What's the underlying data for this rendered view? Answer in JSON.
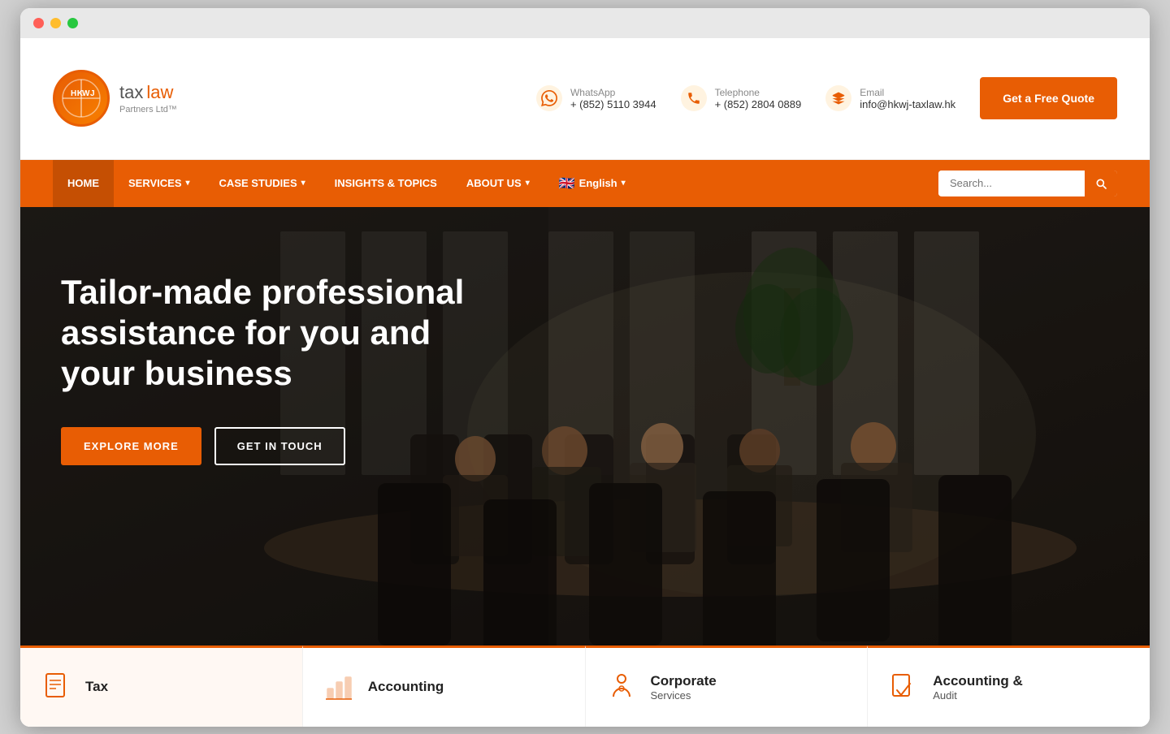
{
  "browser": {
    "dots": [
      "red",
      "yellow",
      "green"
    ]
  },
  "header": {
    "logo_hk": "HK",
    "logo_wj": "WJ",
    "logo_tax": "tax",
    "logo_law": "law",
    "logo_sub": "Partners Ltd™",
    "whatsapp_label": "WhatsApp",
    "whatsapp_number": "+ (852) 5110 3944",
    "telephone_label": "Telephone",
    "telephone_number": "+ (852) 2804 0889",
    "email_label": "Email",
    "email_value": "info@hkwj-taxlaw.hk",
    "quote_btn": "Get a Free Quote"
  },
  "nav": {
    "items": [
      {
        "label": "HOME",
        "has_dropdown": false
      },
      {
        "label": "SERVICES",
        "has_dropdown": true
      },
      {
        "label": "CASE STUDIES",
        "has_dropdown": true
      },
      {
        "label": "INSIGHTS & TOPICS",
        "has_dropdown": false
      },
      {
        "label": "ABOUT US",
        "has_dropdown": true
      }
    ],
    "language": "English",
    "search_placeholder": "Search..."
  },
  "hero": {
    "title": "Tailor-made professional assistance for you and your business",
    "btn_explore": "EXPLORE MORE",
    "btn_touch": "GET IN TOUCH"
  },
  "services": [
    {
      "icon": "📄",
      "title": "Tax"
    },
    {
      "icon": "📊",
      "title": "Accounting"
    },
    {
      "icon": "📈",
      "title": "Corporate"
    },
    {
      "icon": "📋",
      "title": "Accounting &"
    }
  ],
  "bottom_cards": [
    {
      "icon": "📄",
      "title": "Tax",
      "bg": "#fff8f3"
    },
    {
      "icon": "📊",
      "title": "Accounting"
    },
    {
      "icon": "📈",
      "title": "Corporate\nServices"
    },
    {
      "icon": "📋",
      "title": "Accounting &\nAudit"
    }
  ],
  "colors": {
    "orange": "#e85d04",
    "nav_bg": "#e85d04"
  }
}
